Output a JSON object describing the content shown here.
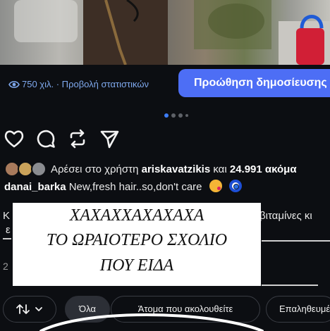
{
  "post": {
    "views_label": "750 χιλ. · Προβολή στατιστικών",
    "promote_button": "Προώθηση δημοσίευσης",
    "carousel": {
      "count": 4,
      "active_index": 0
    },
    "likes": {
      "prefix": "Αρέσει στο χρήστη",
      "user": "ariskavatzikis",
      "middle": "και",
      "others": "24.991 ακόμα"
    },
    "caption": {
      "username": "danai_barka",
      "text": "New,fresh hair..so,don't care"
    }
  },
  "comments": {
    "partial_left_1": "Κ",
    "partial_left_2": "ε",
    "partial_left_time": "2",
    "partial_right_1": "βιταμίνες κι"
  },
  "overlay": {
    "line1": "ΧΑΧΑΧΧΑΧΑΧΑΧΑ",
    "line2": "ΤΟ ΩΡΑΙΟΤΕΡΟ ΣΧΟΛΙΟ",
    "line3": "ΠΟΥ ΕΙΔΑ"
  },
  "filters": {
    "sort_icon": "sort-arrows-icon",
    "all": "Όλα",
    "following": "Άτομα που ακολουθείτε",
    "verified": "Επαληθευμένοι"
  },
  "colors": {
    "background": "#0c0e12",
    "accent_blue": "#4d6ef5",
    "link_blue": "#7fa9ee"
  }
}
